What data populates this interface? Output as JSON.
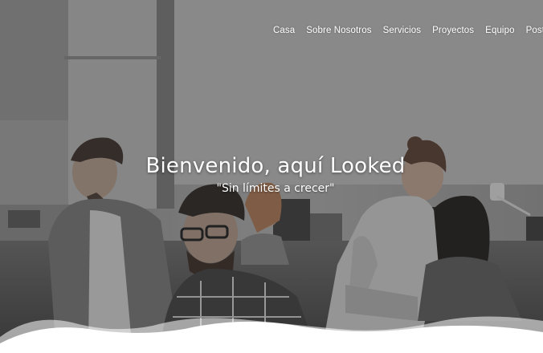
{
  "nav": {
    "items": [
      {
        "label": "Casa"
      },
      {
        "label": "Sobre Nosotros"
      },
      {
        "label": "Servicios"
      },
      {
        "label": "Proyectos"
      },
      {
        "label": "Equipo"
      },
      {
        "label": "Postula"
      }
    ]
  },
  "hero": {
    "title": "Bienvenido, aquí Looked",
    "subtitle": "\"Sin límites a crecer\""
  },
  "colors": {
    "overlay": "#4a4a4a",
    "text": "#ffffff",
    "wave": "#ffffff"
  }
}
